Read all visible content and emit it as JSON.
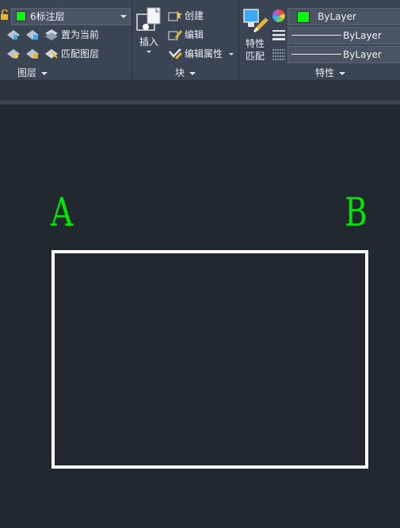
{
  "layer_panel": {
    "current_layer": "6标注层",
    "layer_color": "#00ff00",
    "set_current_label": "置为当前",
    "match_layer_label": "匹配图层",
    "title": "图层"
  },
  "block_panel": {
    "insert_label": "插入",
    "create_label": "创建",
    "edit_label": "编辑",
    "edit_attributes_label": "编辑属性",
    "title": "块"
  },
  "properties_panel": {
    "match_properties_label_1": "特性",
    "match_properties_label_2": "匹配",
    "color_value": "ByLayer",
    "color_swatch": "#00ff00",
    "lineweight_value": "ByLayer",
    "linetype_value": "ByLayer",
    "title": "特性"
  },
  "canvas": {
    "label_a": "A",
    "label_b": "B",
    "text_color": "#00e600",
    "background": "#212830"
  }
}
